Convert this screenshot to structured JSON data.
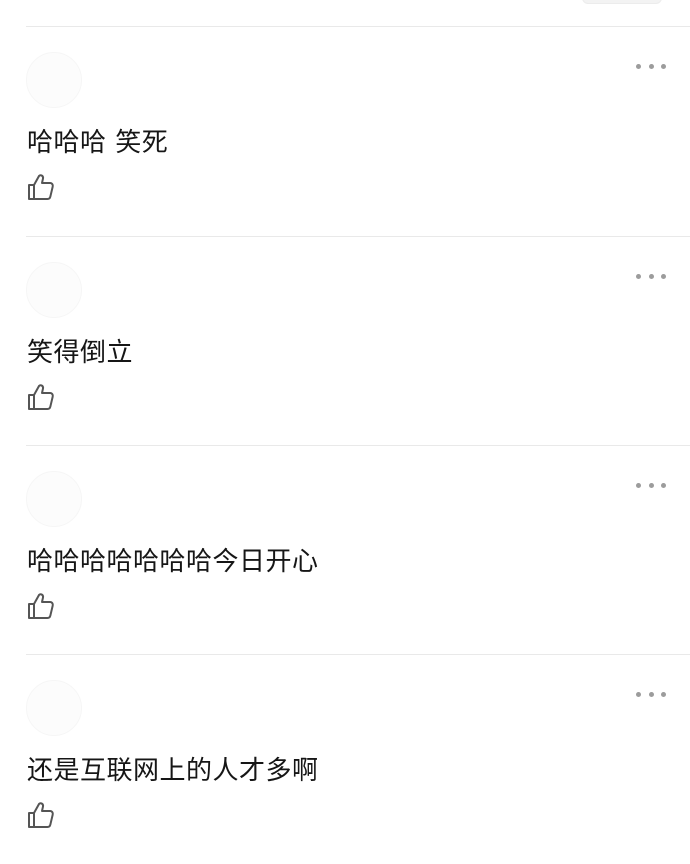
{
  "comments": [
    {
      "text": "哈哈哈  笑死",
      "more_icon": "more-dots-icon",
      "like_icon": "thumbs-up-icon"
    },
    {
      "text": "笑得倒立",
      "more_icon": "more-dots-icon",
      "like_icon": "thumbs-up-icon"
    },
    {
      "text": "哈哈哈哈哈哈哈今日开心",
      "more_icon": "more-dots-icon",
      "like_icon": "thumbs-up-icon"
    },
    {
      "text": "还是互联网上的人才多啊",
      "more_icon": "more-dots-icon",
      "like_icon": "thumbs-up-icon"
    }
  ],
  "colors": {
    "text": "#161616",
    "icon": "#555555",
    "divider": "#e9e9e9",
    "dots": "#9c9c9c"
  }
}
